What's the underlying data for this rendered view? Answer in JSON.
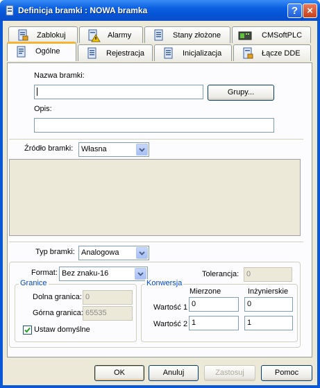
{
  "window": {
    "title": "Definicja bramki : NOWA bramka",
    "help_label": "?",
    "close_label": "×"
  },
  "tabs_row1": [
    {
      "label": "Zablokuj",
      "icon": "lock-page-icon"
    },
    {
      "label": "Alarmy",
      "icon": "alarm-warning-icon"
    },
    {
      "label": "Stany złożone",
      "icon": "composite-states-icon"
    },
    {
      "label": "CMSoftPLC",
      "icon": "plc-icon"
    }
  ],
  "tabs_row2": [
    {
      "label": "Ogólne",
      "icon": "general-page-icon"
    },
    {
      "label": "Rejestracja",
      "icon": "registration-icon"
    },
    {
      "label": "Inicjalizacja",
      "icon": "initialization-icon"
    },
    {
      "label": "Łącze DDE",
      "icon": "dde-link-icon"
    }
  ],
  "general": {
    "name_label": "Nazwa bramki:",
    "name_value": "",
    "groups_button": "Grupy...",
    "description_label": "Opis:",
    "description_value": "",
    "source_label": "Źródło bramki:",
    "source_value": "Własna",
    "type_label": "Typ bramki:",
    "type_value": "Analogowa"
  },
  "analog": {
    "format_label": "Format:",
    "format_value": "Bez znaku-16",
    "tolerance_label": "Tolerancja:",
    "tolerance_value": "0",
    "limits_group": "Granice",
    "lower_label": "Dolna granica:",
    "lower_value": "0",
    "upper_label": "Górna granica:",
    "upper_value": "65535",
    "defaults_label": "Ustaw domyślne",
    "defaults_checked": true,
    "conversion_group": "Konwersja",
    "measured_header": "Mierzone",
    "engineering_header": "Inżynierskie",
    "value1_label": "Wartość 1",
    "value2_label": "Wartość 2",
    "v1_measured": "0",
    "v1_engineering": "0",
    "v2_measured": "1",
    "v2_engineering": "1"
  },
  "buttons": {
    "ok": "OK",
    "cancel": "Anuluj",
    "apply": "Zastosuj",
    "help": "Pomoc"
  }
}
